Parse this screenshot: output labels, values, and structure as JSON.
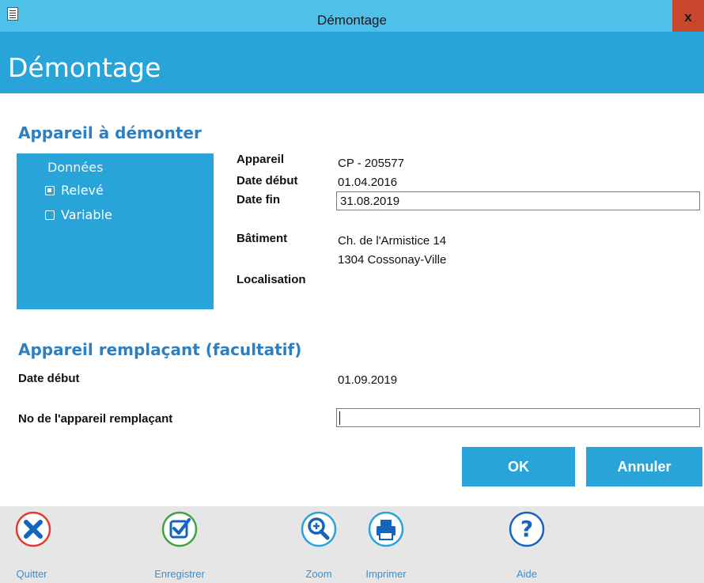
{
  "window": {
    "title": "Démontage",
    "close_label": "x"
  },
  "header": {
    "title": "Démontage"
  },
  "section1": {
    "heading": "Appareil à démonter",
    "panel": {
      "title": "Données",
      "options": [
        {
          "label": "Relevé",
          "checked": true
        },
        {
          "label": "Variable",
          "checked": false
        }
      ]
    },
    "fields": {
      "appareil_label": "Appareil",
      "appareil_value": "CP - 205577",
      "date_debut_label": "Date début",
      "date_debut_value": "01.04.2016",
      "date_fin_label": "Date fin",
      "date_fin_value": "31.08.2019",
      "batiment_label": "Bâtiment",
      "batiment_line1": "Ch. de l'Armistice 14",
      "batiment_line2": "1304 Cossonay-Ville",
      "localisation_label": "Localisation"
    }
  },
  "section2": {
    "heading": "Appareil remplaçant (facultatif)",
    "date_debut_label": "Date début",
    "date_debut_value": "01.09.2019",
    "no_label": "No de l'appareil remplaçant",
    "no_value": ""
  },
  "buttons": {
    "ok": "OK",
    "cancel": "Annuler"
  },
  "toolbar": [
    {
      "label": "Quitter",
      "icon": "close-circle-icon",
      "color": "#e53935"
    },
    {
      "label": "Enregistrer",
      "icon": "checkbox-check-icon",
      "color": "#43a047"
    },
    {
      "label": "Zoom",
      "icon": "zoom-in-icon",
      "color": "#1e88e5"
    },
    {
      "label": "Imprimer",
      "icon": "printer-icon",
      "color": "#1e88e5"
    },
    {
      "label": "Aide",
      "icon": "help-icon",
      "color": "#1e88e5"
    }
  ],
  "colors": {
    "accent": "#29a4d9",
    "titlebar": "#4fc0ea",
    "heading": "#2e7fbf",
    "close": "#c9462c",
    "footer": "#e6e6e6"
  }
}
